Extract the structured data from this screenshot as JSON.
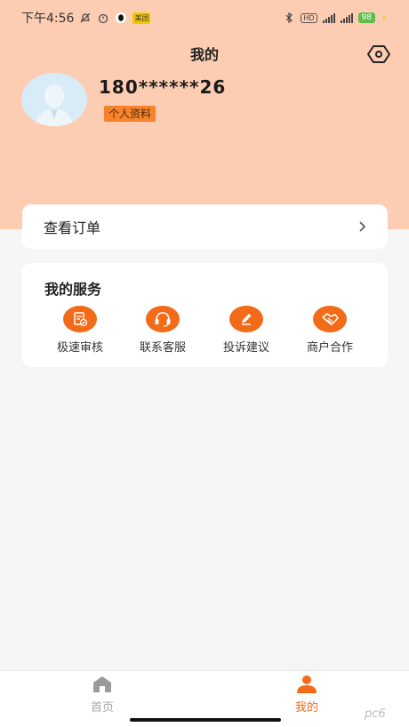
{
  "status_bar": {
    "time": "下午4:56",
    "app_badge": "美团",
    "hd_label": "HD",
    "battery": "98"
  },
  "header": {
    "title": "我的"
  },
  "profile": {
    "phone": "180******26",
    "profile_link": "个人资料"
  },
  "orders": {
    "label": "查看订单"
  },
  "services": {
    "title": "我的服务",
    "items": [
      {
        "label": "极速审核",
        "icon": "document-check-icon"
      },
      {
        "label": "联系客服",
        "icon": "headset-icon"
      },
      {
        "label": "投诉建议",
        "icon": "pencil-icon"
      },
      {
        "label": "商户合作",
        "icon": "handshake-icon"
      }
    ]
  },
  "tabbar": {
    "tabs": [
      {
        "label": "首页",
        "icon": "home-icon",
        "active": false
      },
      {
        "label": "我的",
        "icon": "person-icon",
        "active": true
      }
    ]
  },
  "colors": {
    "header_bg": "#fccdb2",
    "accent": "#f26b18",
    "inactive": "#a8a8a8"
  },
  "watermark": "pc6"
}
